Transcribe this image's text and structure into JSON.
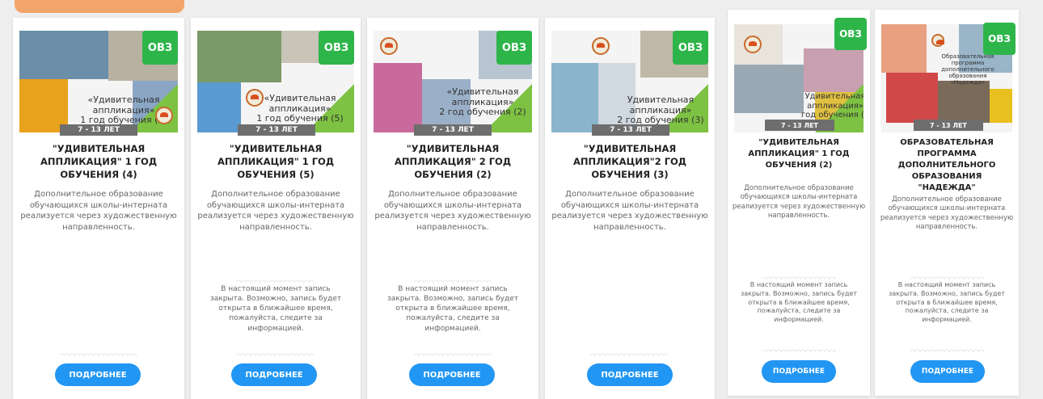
{
  "colors": {
    "badge": "#2eb54a",
    "button": "#2196f3",
    "age_band": "#6e6e6e",
    "accent_green": "#7dc242"
  },
  "cards": [
    {
      "badge": "ОВЗ",
      "image_caption_1": "«Удивительная",
      "image_caption_2": "аппликация»",
      "image_caption_3": "1 год обучения (4)",
      "age": "7 - 13 ЛЕТ",
      "title": "\"УДИВИТЕЛЬНАЯ АППЛИКАЦИЯ\" 1 ГОД ОБУЧЕНИЯ (4)",
      "description": "Дополнительное образование обучающихся школы-интерната реализуется через художественную направленность.",
      "notice": "",
      "button": "ПОДРОБНЕЕ"
    },
    {
      "badge": "ОВЗ",
      "image_caption_1": "«Удивительная",
      "image_caption_2": "аппликация»",
      "image_caption_3": "1 год обучения (5)",
      "age": "7 - 13 ЛЕТ",
      "title": "\"УДИВИТЕЛЬНАЯ АППЛИКАЦИЯ\" 1 ГОД ОБУЧЕНИЯ (5)",
      "description": "Дополнительное образование обучающихся школы-интерната реализуется через художественную направленность.",
      "notice": "В настоящий момент запись закрыта. Возможно, запись будет открыта в ближайшее время, пожалуйста, следите за информацией.",
      "button": "ПОДРОБНЕЕ"
    },
    {
      "badge": "ОВЗ",
      "image_caption_1": "«Удивительная",
      "image_caption_2": "аппликация»",
      "image_caption_3": "2 год обучения (2)",
      "age": "7 - 13 ЛЕТ",
      "title": "\"УДИВИТЕЛЬНАЯ АППЛИКАЦИЯ\" 2 ГОД ОБУЧЕНИЯ (2)",
      "description": "Дополнительное образование обучающихся школы-интерната реализуется через художественную направленность.",
      "notice": "В настоящий момент запись закрыта. Возможно, запись будет открыта в ближайшее время, пожалуйста, следите за информацией.",
      "button": "ПОДРОБНЕЕ"
    },
    {
      "badge": "ОВЗ",
      "image_caption_1": "Удивительная",
      "image_caption_2": "аппликация»",
      "image_caption_3": "2 год обучения (3)",
      "age": "7 - 13 ЛЕТ",
      "title": "\"УДИВИТЕЛЬНАЯ АППЛИКАЦИЯ\"2 ГОД ОБУЧЕНИЯ (3)",
      "description": "Дополнительное образование обучающихся школы-интерната реализуется через художественную направленность.",
      "notice": "",
      "button": "ПОДРОБНЕЕ"
    },
    {
      "badge": "ОВЗ",
      "image_caption_1": "Удивительная",
      "image_caption_2": "аппликация»",
      "image_caption_3": "год обучения (2",
      "age": "7 - 13 ЛЕТ",
      "title": "\"УДИВИТЕЛЬНАЯ АППЛИКАЦИЯ\" 1 ГОД ОБУЧЕНИЯ (2)",
      "description": "Дополнительное образование обучающихся школы-интерната реализуется через художественную направленность.",
      "notice": "В настоящий момент запись закрыта. Возможно, запись будет открыта в ближайшее время, пожалуйста, следите за информацией.",
      "button": "ПОДРОБНЕЕ"
    },
    {
      "badge": "ОВЗ",
      "image_caption_1": "Образовательная программа",
      "image_caption_2": "дополнительного образования",
      "image_caption_3": "«Надежда»",
      "age": "7 - 13 ЛЕТ",
      "title": "ОБРАЗОВАТЕЛЬНАЯ ПРОГРАММА ДОПОЛНИТЕЛЬНОГО ОБРАЗОВАНИЯ \"НАДЕЖДА\"",
      "description": "Дополнительное образование обучающихся школы-интерната реализуется через художественную направленность.",
      "notice": "В настоящий момент запись закрыта. Возможно, запись будет открыта в ближайшее время, пожалуйста, следите за информацией.",
      "button": "ПОДРОБНЕЕ"
    }
  ]
}
